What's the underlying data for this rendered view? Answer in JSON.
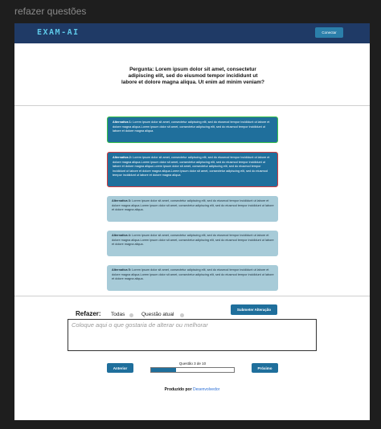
{
  "frame_label": "refazer questões",
  "header": {
    "logo": "EXAM-AI",
    "connect_label": "Conectar"
  },
  "question": {
    "text": "Pergunta: Lorem ipsum dolor sit amet, consectetur adipiscing elit, sed do eiusmod tempor incididunt ut labore et dolore magna aliqua. Ut enim ad minim veniam?"
  },
  "alternatives": [
    {
      "label": "Alternativa 1:",
      "text": "Lorem ipsum dolor sit amet, consectetur adipiscing elit, sed do eiusmod tempor incididunt ut labore et dolore magna aliqua.Lorem ipsum dolor sit amet, consectetur adipiscing elit, sed do eiusmod tempor incididunt ut labore et dolore magna aliqua.",
      "state": "correct"
    },
    {
      "label": "Alternativa 2:",
      "text": "Lorem ipsum dolor sit amet, consectetur adipiscing elit, sed do eiusmod tempor incididunt ut labore et dolore magna aliqua.Lorem ipsum dolor sit amet, consectetur adipiscing elit, sed do eiusmod tempor incididunt ut labore et dolore magna aliqua.Lorem ipsum dolor sit amet, consectetur adipiscing elit, sed do eiusmod tempor incididunt ut labore et dolore magna aliqua.Lorem ipsum dolor sit amet, consectetur adipiscing elit, sed do eiusmod tempor incididunt ut labore et dolore magna aliqua",
      "state": "wrong"
    },
    {
      "label": "Alternativa 3:",
      "text": "Lorem ipsum dolor sit amet, consectetur adipiscing elit, sed do eiusmod tempor incididunt ut labore et dolore magna aliqua.Lorem ipsum dolor sit amet, consectetur adipiscing elit, sed do eiusmod tempor incididunt ut labore et dolore magna aliqua.",
      "state": "neutral"
    },
    {
      "label": "Alternativa 4:",
      "text": "Lorem ipsum dolor sit amet, consectetur adipiscing elit, sed do eiusmod tempor incididunt ut labore et dolore magna aliqua.Lorem ipsum dolor sit amet, consectetur adipiscing elit, sed do eiusmod tempor incididunt ut labore et dolore magna aliqua.",
      "state": "neutral"
    },
    {
      "label": "Alternativa 5:",
      "text": "Lorem ipsum dolor sit amet, consectetur adipiscing elit, sed do eiusmod tempor incididunt ut labore et dolore magna aliqua.Lorem ipsum dolor sit amet, consectetur adipiscing elit, sed do eiusmod tempor incididunt ut labore et dolore magna aliqua.",
      "state": "neutral"
    }
  ],
  "redo": {
    "title": "Refazer:",
    "option_all": "Todas",
    "option_current": "Questão atual",
    "submit_label": "Submeter Alteração",
    "placeholder": "Coloque aqui o que gostaria de alterar ou melhorar"
  },
  "pagination": {
    "prev_label": "Anterior",
    "next_label": "Próximo",
    "progress_label": "Questão 3 de 10",
    "progress_fraction": 0.3
  },
  "footer": {
    "prefix": "Produzido por",
    "link": "Desenvolvedor"
  },
  "colors": {
    "navbar": "#1f3a66",
    "accent": "#1f6f9c",
    "correct_border": "#3cc24a",
    "wrong_border": "#d8383a",
    "neutral_alt": "#a7cbd8"
  }
}
